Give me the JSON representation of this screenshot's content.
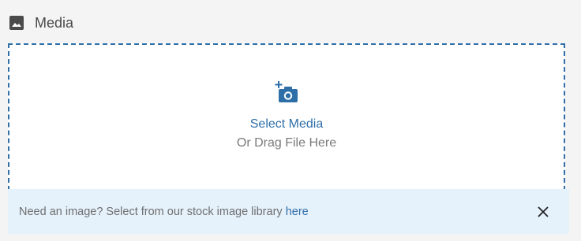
{
  "header": {
    "title": "Media",
    "icon": "image-icon"
  },
  "dropzone": {
    "icon": "add-camera-icon",
    "select_label": "Select Media",
    "drag_label": "Or Drag File Here"
  },
  "notice": {
    "text": "Need an image? Select from our stock image library ",
    "link_label": "here",
    "close_icon": "close-icon"
  },
  "colors": {
    "accent": "#2f6fa8",
    "notice_bg": "#e5f1fb",
    "page_bg": "#f4f4f4"
  }
}
